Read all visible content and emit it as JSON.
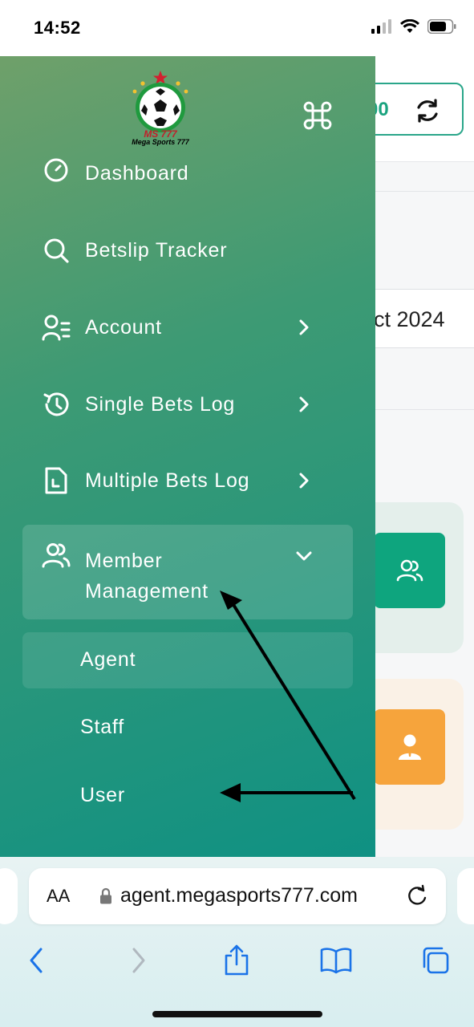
{
  "status_bar": {
    "time": "14:52"
  },
  "background": {
    "balance_value": "00",
    "date_text": "ct 2024"
  },
  "logo": {
    "title": "MS 777",
    "subtitle": "Mega Sports 777"
  },
  "menu": {
    "partial_item": "Dashboard",
    "items": [
      {
        "label": "Betslip Tracker",
        "icon": "search-icon"
      },
      {
        "label": "Account",
        "icon": "account-icon"
      },
      {
        "label": "Single Bets Log",
        "icon": "history-icon"
      },
      {
        "label": "Multiple Bets Log",
        "icon": "document-icon"
      }
    ],
    "member_management": {
      "label": "Member Management",
      "sub_items": [
        "Agent",
        "Staff",
        "User"
      ]
    }
  },
  "browser": {
    "aa_label": "AA",
    "url": "agent.megasports777.com"
  },
  "colors": {
    "menu_gradient_start": "#6fa06a",
    "menu_gradient_end": "#0f9183",
    "accent_green": "#0ea57e",
    "accent_orange": "#f6a43c",
    "ios_blue": "#1a73e8"
  }
}
